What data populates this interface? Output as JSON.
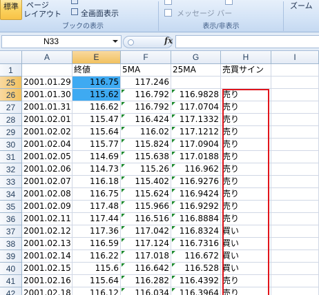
{
  "ribbon": {
    "active_button": "標準",
    "page_layout_line1": "ページ",
    "page_layout_line2": "レイアウト",
    "fullscreen": "全画面表示",
    "group_book_view": "ブックの表示",
    "message_bar": "メッセージ バー",
    "group_show_hide": "表示/非表示",
    "zoom": "ズーム"
  },
  "formula_bar": {
    "name_box": "N33",
    "fx_symbol": "fx",
    "formula": ""
  },
  "columns": [
    "A",
    "E",
    "F",
    "G",
    "H",
    "I"
  ],
  "header_row": {
    "row_num": "1",
    "cells": [
      "",
      "終値",
      "5MA",
      "25MA",
      "売買サイン",
      ""
    ]
  },
  "rows": [
    {
      "n": "25",
      "date": "2001.01.29",
      "close": "116.75",
      "ma5": "117.246",
      "ma25": "",
      "signal": ""
    },
    {
      "n": "26",
      "date": "2001.01.30",
      "close": "115.62",
      "ma5": "116.792",
      "ma25": "116.9828",
      "signal": "売り"
    },
    {
      "n": "27",
      "date": "2001.01.31",
      "close": "116.62",
      "ma5": "116.792",
      "ma25": "117.0704",
      "signal": "売り"
    },
    {
      "n": "28",
      "date": "2001.02.01",
      "close": "115.47",
      "ma5": "116.424",
      "ma25": "117.1332",
      "signal": "売り"
    },
    {
      "n": "29",
      "date": "2001.02.02",
      "close": "115.64",
      "ma5": "116.02",
      "ma25": "117.1212",
      "signal": "売り"
    },
    {
      "n": "30",
      "date": "2001.02.04",
      "close": "115.77",
      "ma5": "115.824",
      "ma25": "117.0904",
      "signal": "売り"
    },
    {
      "n": "31",
      "date": "2001.02.05",
      "close": "114.69",
      "ma5": "115.638",
      "ma25": "117.0188",
      "signal": "売り"
    },
    {
      "n": "32",
      "date": "2001.02.06",
      "close": "114.73",
      "ma5": "115.26",
      "ma25": "116.962",
      "signal": "売り"
    },
    {
      "n": "33",
      "date": "2001.02.07",
      "close": "116.18",
      "ma5": "115.402",
      "ma25": "116.9276",
      "signal": "売り"
    },
    {
      "n": "34",
      "date": "2001.02.08",
      "close": "116.75",
      "ma5": "115.624",
      "ma25": "116.9424",
      "signal": "売り"
    },
    {
      "n": "35",
      "date": "2001.02.09",
      "close": "117.48",
      "ma5": "115.966",
      "ma25": "116.9292",
      "signal": "売り"
    },
    {
      "n": "36",
      "date": "2001.02.11",
      "close": "117.44",
      "ma5": "116.516",
      "ma25": "116.8884",
      "signal": "売り"
    },
    {
      "n": "37",
      "date": "2001.02.12",
      "close": "117.36",
      "ma5": "117.042",
      "ma25": "116.8324",
      "signal": "買い"
    },
    {
      "n": "38",
      "date": "2001.02.13",
      "close": "116.59",
      "ma5": "117.124",
      "ma25": "116.7316",
      "signal": "買い"
    },
    {
      "n": "39",
      "date": "2001.02.14",
      "close": "116.22",
      "ma5": "117.018",
      "ma25": "116.672",
      "signal": "買い"
    },
    {
      "n": "40",
      "date": "2001.02.15",
      "close": "115.6",
      "ma5": "116.642",
      "ma25": "116.528",
      "signal": "買い"
    },
    {
      "n": "41",
      "date": "2001.02.16",
      "close": "115.64",
      "ma5": "116.282",
      "ma25": "116.4392",
      "signal": "売り"
    },
    {
      "n": "42",
      "date": "2001.02.18",
      "close": "116.12",
      "ma5": "116.034",
      "ma25": "116.3964",
      "signal": "売り"
    }
  ],
  "colors": {
    "selection": "#3eaaf2",
    "highlight_box": "#e0141b",
    "error_indicator": "#1c8a2e"
  }
}
